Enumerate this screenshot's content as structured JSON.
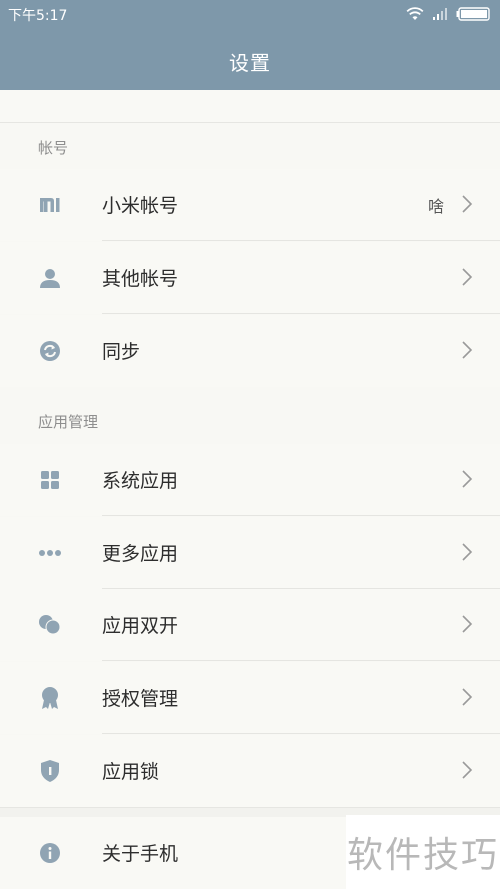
{
  "status": {
    "time": "下午5:17"
  },
  "header": {
    "title": "设置"
  },
  "sections": {
    "account": {
      "title": "帐号",
      "items": [
        {
          "label": "小米帐号",
          "value": "啥",
          "icon": "mi-logo-icon"
        },
        {
          "label": "其他帐号",
          "icon": "person-icon"
        },
        {
          "label": "同步",
          "icon": "sync-icon"
        }
      ]
    },
    "apps": {
      "title": "应用管理",
      "items": [
        {
          "label": "系统应用",
          "icon": "grid-icon"
        },
        {
          "label": "更多应用",
          "icon": "more-dots-icon"
        },
        {
          "label": "应用双开",
          "icon": "dual-app-icon"
        },
        {
          "label": "授权管理",
          "icon": "badge-icon"
        },
        {
          "label": "应用锁",
          "icon": "shield-lock-icon"
        }
      ]
    },
    "about": {
      "items": [
        {
          "label": "关于手机",
          "icon": "info-icon"
        }
      ]
    }
  },
  "watermark": {
    "text": "软件技巧"
  },
  "colors": {
    "header": "#7e98aa",
    "icon": "#90a4b3",
    "background": "#f9f9f5"
  }
}
